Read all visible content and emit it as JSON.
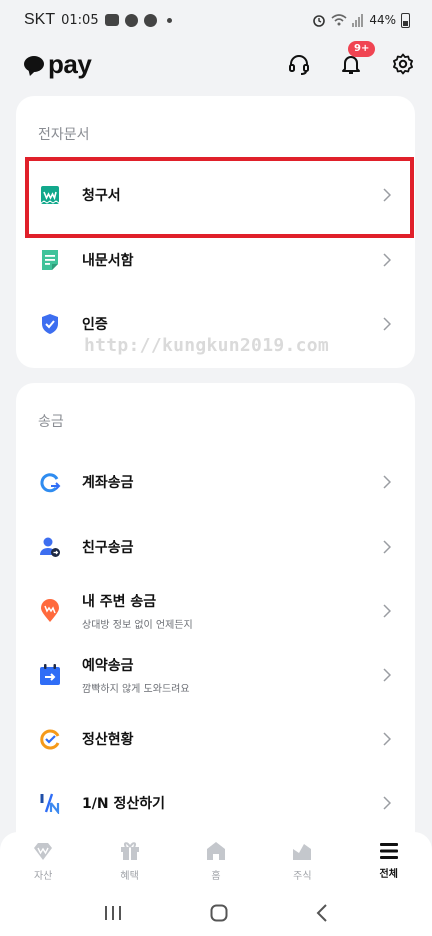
{
  "status_bar": {
    "carrier": "SKT",
    "time": "01:05",
    "battery": "44%"
  },
  "header": {
    "logo_text": "pay",
    "notification_badge": "9+"
  },
  "documents": {
    "title": "전자문서",
    "items": [
      {
        "label": "청구서",
        "icon": "invoice-icon",
        "highlighted": true
      },
      {
        "label": "내문서함",
        "icon": "document-list-icon"
      },
      {
        "label": "인증",
        "icon": "shield-check-icon"
      }
    ]
  },
  "watermark": "http://kungkun2019.com",
  "transfer": {
    "title": "송금",
    "items": [
      {
        "label": "계좌송금",
        "icon": "account-transfer-icon"
      },
      {
        "label": "친구송금",
        "icon": "friend-transfer-icon"
      },
      {
        "label": "내 주변 송금",
        "sub": "상대방 정보 없이 언제든지",
        "icon": "nearby-transfer-icon"
      },
      {
        "label": "예약송금",
        "sub": "깜빡하지 않게 도와드려요",
        "icon": "scheduled-transfer-icon"
      },
      {
        "label": "정산현황",
        "icon": "settlement-status-icon"
      },
      {
        "label": "1/N 정산하기",
        "icon": "split-bill-icon"
      }
    ]
  },
  "bottom_nav": [
    {
      "label": "자산",
      "icon": "asset-icon"
    },
    {
      "label": "혜택",
      "icon": "gift-icon"
    },
    {
      "label": "홈",
      "icon": "home-icon"
    },
    {
      "label": "주식",
      "icon": "stock-icon"
    },
    {
      "label": "전체",
      "icon": "menu-icon",
      "active": true
    }
  ],
  "colors": {
    "accent_red": "#e0202a",
    "badge_red": "#f04452",
    "teal": "#12a88c",
    "blue": "#2f6df6",
    "orange": "#f59a1b"
  }
}
